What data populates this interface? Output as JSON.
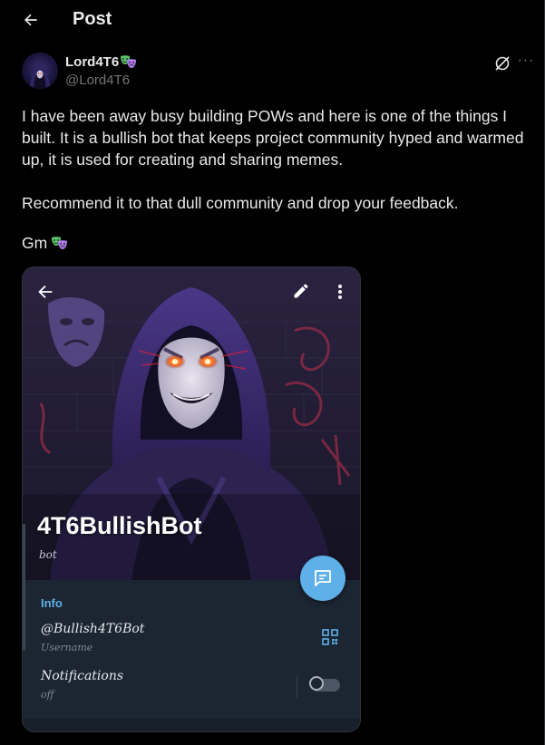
{
  "header": {
    "title": "Post",
    "back_icon": "arrow-left-icon"
  },
  "author": {
    "display_name": "Lord4T6",
    "handle": "@Lord4T6",
    "badge_icon": "theater-masks-icon",
    "actions": [
      "grok-icon",
      "more-icon"
    ],
    "more_glyph": "···"
  },
  "tweet": {
    "paragraph_1": "I have been away busy building POWs and here is one of the things I built. It is a bullish bot that keeps project community hyped and warmed up, it is used for creating and sharing memes.",
    "paragraph_2": "Recommend it to that dull community and drop your feedback.",
    "paragraph_3": "Gm"
  },
  "media": {
    "bot_name": "4T6BullishBot",
    "bot_subtitle": "bot",
    "info_title": "Info",
    "username_value": "@Bullish4T6Bot",
    "username_label": "Username",
    "notifications_label": "Notifications",
    "notifications_value": "off",
    "notifications_enabled": false,
    "icons": [
      "arrow-left-icon",
      "pencil-icon",
      "kebab-menu-icon",
      "message-icon",
      "qr-code-icon"
    ]
  },
  "colors": {
    "background": "#000000",
    "text": "#e7e9ea",
    "muted": "#71767b",
    "accent": "#5eb0e8",
    "panel": "#1c2532"
  }
}
